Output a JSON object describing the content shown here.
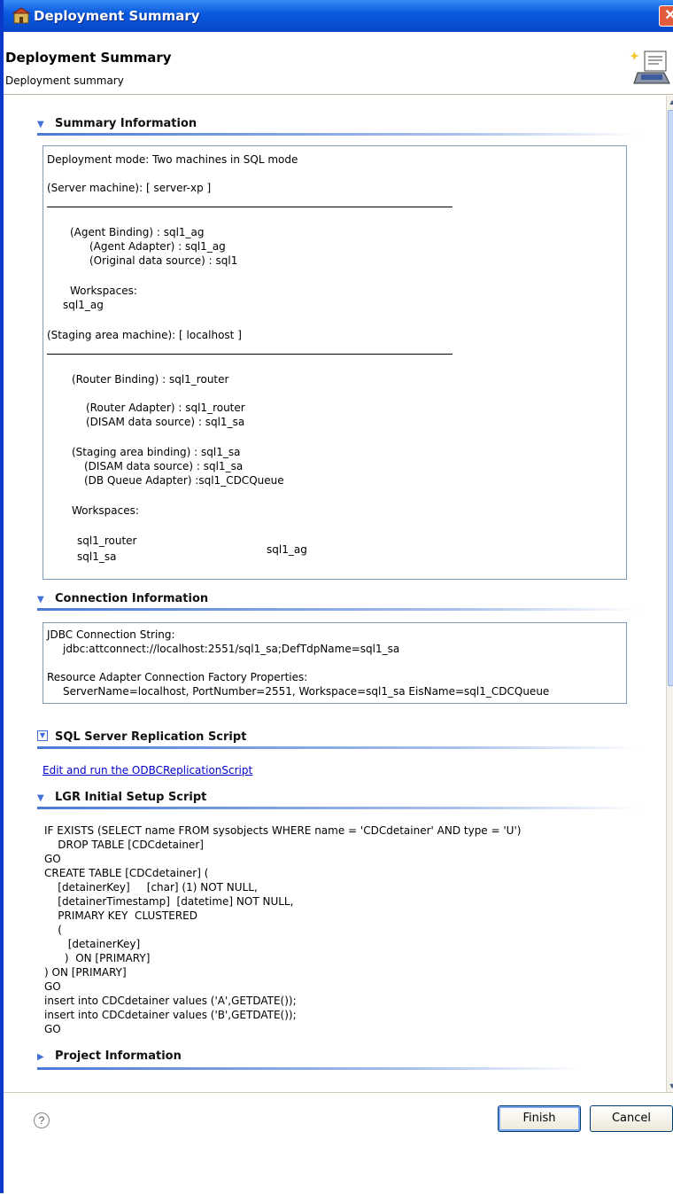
{
  "window": {
    "title": "Deployment Summary",
    "close_label": "✕"
  },
  "header": {
    "title": "Deployment Summary",
    "subtitle": "Deployment summary"
  },
  "summary": {
    "heading": "Summary Information",
    "deployment_mode": "Deployment mode:  Two machines in SQL mode",
    "server_machine": "(Server machine):  [ server-xp ]",
    "agent_binding": "(Agent Binding)              :  sql1_ag",
    "agent_adapter": "(Agent Adapter)         :  sql1_ag",
    "original_ds": "(Original data source) : sql1",
    "workspaces_label": "Workspaces:",
    "workspace_ag": "sql1_ag",
    "staging_machine": "(Staging area machine): [ localhost ]",
    "router_binding": "(Router Binding)           : sql1_router",
    "router_adapter": "(Router Adapter)       : sql1_router",
    "disam_ds_1": "(DISAM data source)  :  sql1_sa",
    "staging_binding": "(Staging area binding)   : sql1_sa",
    "disam_ds_2": "(DISAM data source)  : sql1_sa",
    "dbqueue_adapter": "(DB Queue Adapter)    :sql1_CDCQueue",
    "workspaces_label_2": "Workspaces:",
    "ws_router": "sql1_router",
    "ws_sa": "sql1_sa",
    "ws_ag": "sql1_ag"
  },
  "connection": {
    "heading": "Connection Information",
    "jdbc_label": "JDBC Connection String:",
    "jdbc_value": "jdbc:attconnect://localhost:2551/sql1_sa;DefTdpName=sql1_sa",
    "ra_label": "Resource Adapter Connection Factory Properties:",
    "ra_value": "ServerName=localhost, PortNumber=2551, Workspace=sql1_sa EisName=sql1_CDCQueue"
  },
  "sql_replication": {
    "heading": "SQL Server Replication Script",
    "link": "Edit and run the ODBCReplicationScript"
  },
  "lgr": {
    "heading": "LGR Initial Setup Script",
    "lines": [
      "IF EXISTS (SELECT name FROM sysobjects WHERE name = 'CDCdetainer' AND type = 'U')",
      "    DROP TABLE [CDCdetainer]",
      "GO",
      "CREATE TABLE [CDCdetainer] (",
      "    [detainerKey]     [char] (1) NOT NULL,",
      "    [detainerTimestamp]  [datetime] NOT NULL,",
      "    PRIMARY KEY  CLUSTERED",
      "    (",
      "       [detainerKey]",
      "      )  ON [PRIMARY]",
      ") ON [PRIMARY]",
      "GO",
      "insert into CDCdetainer values ('A',GETDATE());",
      "insert into CDCdetainer values ('B',GETDATE());",
      "GO"
    ]
  },
  "project": {
    "heading": "Project Information"
  },
  "footer": {
    "help": "?",
    "finish": "Finish",
    "cancel": "Cancel"
  },
  "icons": {
    "expanded": "▼",
    "collapsed": "▶",
    "twisty": "▼"
  },
  "colors": {
    "titlebar": "#0a5be0",
    "section_line": "#4a7ad8",
    "link": "#0000cc"
  }
}
